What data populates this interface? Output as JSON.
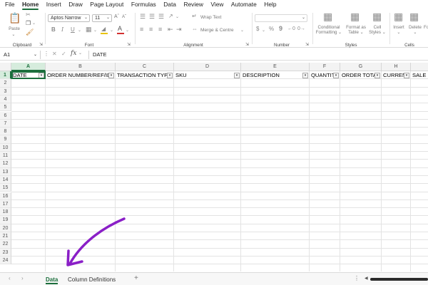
{
  "menu": {
    "tabs": [
      "File",
      "Home",
      "Insert",
      "Draw",
      "Page Layout",
      "Formulas",
      "Data",
      "Review",
      "View",
      "Automate",
      "Help"
    ],
    "active": "Home"
  },
  "ribbon": {
    "clipboard": {
      "label": "Clipboard",
      "paste": "Paste"
    },
    "font": {
      "label": "Font",
      "font_name": "Aptos Narrow",
      "font_size": "11",
      "bold": "B",
      "italic": "I",
      "underline": "U"
    },
    "alignment": {
      "label": "Alignment",
      "wrap_text": "Wrap Text",
      "merge_center": "Merge & Centre"
    },
    "number": {
      "label": "Number",
      "currency": "$",
      "percent": "%",
      "comma": "9"
    },
    "styles": {
      "label": "Styles",
      "conditional_l1": "Conditional",
      "conditional_l2": "Formatting",
      "format_table_l1": "Format as",
      "format_table_l2": "Table",
      "cell_styles_l1": "Cell",
      "cell_styles_l2": "Styles"
    },
    "cells": {
      "label": "Cells",
      "insert": "Insert",
      "delete": "Delete",
      "format": "Fo"
    }
  },
  "formula_bar": {
    "name_box": "A1",
    "fx": "fx",
    "value": "DATE"
  },
  "grid": {
    "columns": [
      "A",
      "B",
      "C",
      "D",
      "E",
      "F",
      "G",
      "H",
      "I"
    ],
    "rows": [
      "1",
      "2",
      "3",
      "4",
      "5",
      "6",
      "7",
      "8",
      "9",
      "10",
      "11",
      "12",
      "13",
      "14",
      "15",
      "16",
      "17",
      "18",
      "19",
      "20",
      "21",
      "22",
      "23",
      "24"
    ],
    "headers": [
      "DATE",
      "ORDER NUMBER/REF/ID",
      "TRANSACTION TYPE",
      "SKU",
      "DESCRIPTION",
      "QUANTITY",
      "ORDER TOTAL",
      "CURRENCY",
      "SALE"
    ],
    "active_cell": "A1"
  },
  "sheets": {
    "tabs": [
      "Data",
      "Column Definitions"
    ],
    "active": "Data",
    "add": "+"
  },
  "colors": {
    "accent": "#1b6e3c",
    "annotation_arrow": "#8a1fc7"
  }
}
